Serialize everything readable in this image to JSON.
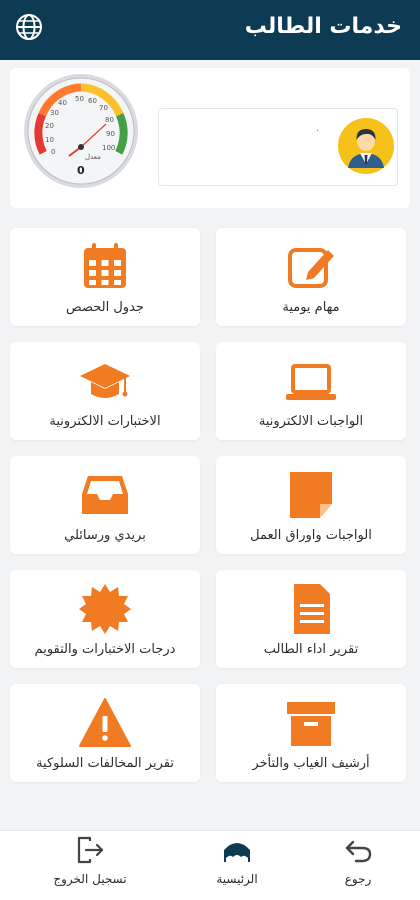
{
  "header": {
    "title": "خدمات الطالب",
    "icon": "globe-icon",
    "background": "#0d3b54"
  },
  "profile": {
    "gauge": {
      "ticks": [
        "0",
        "10",
        "20",
        "30",
        "40",
        "50",
        "60",
        "70",
        "80",
        "90",
        "100"
      ],
      "caption": "معدل",
      "value": "0"
    },
    "info_text": "·",
    "avatar_icon": "student-avatar-icon"
  },
  "accent": "#f07b22",
  "tiles": [
    {
      "label": "مهام يومية",
      "icon": "edit-square-icon"
    },
    {
      "label": "جدول الحصص",
      "icon": "calendar-icon"
    },
    {
      "label": "الواجبات الالكترونية",
      "icon": "laptop-icon"
    },
    {
      "label": "الاختبارات الالكترونية",
      "icon": "graduation-cap-icon"
    },
    {
      "label": "الواجبات واوراق العمل",
      "icon": "sticky-note-icon"
    },
    {
      "label": "بريدي ورسائلي",
      "icon": "inbox-tray-icon"
    },
    {
      "label": "تقرير اداء الطالب",
      "icon": "document-icon"
    },
    {
      "label": "درجات الاختبارات والتقويم",
      "icon": "badge-icon"
    },
    {
      "label": "أرشيف الغياب والتأخر",
      "icon": "archive-box-icon"
    },
    {
      "label": "تقرير المخالفات السلوكية",
      "icon": "warning-icon"
    }
  ],
  "bottom_nav": {
    "back": "رجوع",
    "home": "الرئيسية",
    "logout": "تسجيل الخروج"
  }
}
